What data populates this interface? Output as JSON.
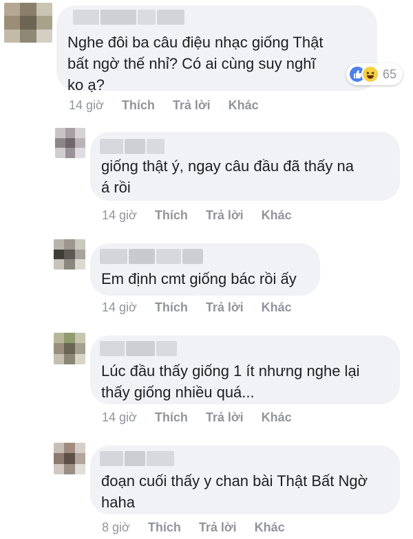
{
  "thread": {
    "comments": [
      {
        "text": "Nghe đôi ba câu điệu nhạc giống Thật\nbất ngờ thế nhỉ? Có ai cùng suy nghĩ\nko ạ?",
        "time": "14 giờ",
        "like": "Thích",
        "reply": "Trả lời",
        "more": "Khác",
        "reactions": {
          "count": "65",
          "types": [
            "like-icon",
            "haha-icon"
          ],
          "like_color": "#4c7ff0",
          "haha_color": "#f6cf45"
        }
      },
      {
        "text": "giống thật ý, ngay câu đầu đã thấy na\ná rồi",
        "time": "14 giờ",
        "like": "Thích",
        "reply": "Trả lời",
        "more": "Khác"
      },
      {
        "text": "Em định cmt giống bác rồi ấy",
        "time": "14 giờ",
        "like": "Thích",
        "reply": "Trả lời",
        "more": "Khác"
      },
      {
        "text": "Lúc đầu thấy giống 1 ít nhưng nghe lại\nthấy giống nhiều quá...",
        "time": "14 giờ",
        "like": "Thích",
        "reply": "Trả lời",
        "more": "Khác"
      },
      {
        "text": "đoạn cuối thấy y chan bài Thật Bất Ngờ\nhaha",
        "time": "8 giờ",
        "like": "Thích",
        "reply": "Trả lời",
        "more": "Khác"
      }
    ]
  },
  "colors": {
    "bubble": "#f1f2f6",
    "text": "#1c1e21",
    "meta": "#90949c"
  }
}
